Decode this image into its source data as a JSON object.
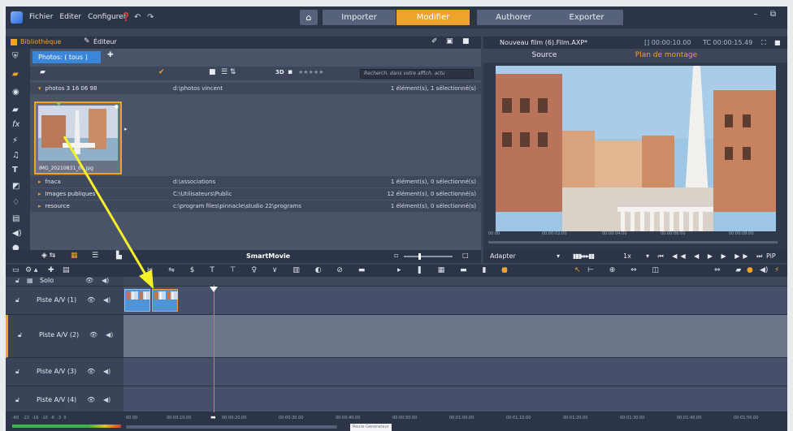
{
  "menu": {
    "file": "Fichier",
    "edit": "Editer",
    "config": "Configurer"
  },
  "nav_tabs": {
    "import": "Importer",
    "edit": "Modifier",
    "author": "Authorer",
    "export": "Exporter"
  },
  "library": {
    "header": "Bibliothèque",
    "editor": "Éditeur",
    "photos_tab": "Photos: ( tous )",
    "search_placeholder": "Recherch. dans votre affich. actu",
    "rows": [
      {
        "name": "photos 3 16 06 98",
        "path": "d:\\photos vincent",
        "count": "1 élément(s), 1 sélectionné(s)"
      },
      {
        "name": "fnaca",
        "path": "d:\\associations",
        "count": "1 élément(s), 0 sélectionné(s)"
      },
      {
        "name": "Images publiques",
        "path": "C:\\Utilisateurs\\Public",
        "count": "12 élément(s), 0 sélectionné(s)"
      },
      {
        "name": "resource",
        "path": "c:\\program files\\pinnacle\\studio 22\\programs",
        "count": "1 élément(s), 0 sélectionné(s)"
      }
    ],
    "thumb_caption": "IMG_20210831_0...jpg",
    "smartmovie": "SmartMovie"
  },
  "player": {
    "title": "Nouveau film (6).Film.AXP*",
    "tc1": "[] 00:00:10.00",
    "tc2": "TC 00:00:15.49",
    "tab_source": "Source",
    "tab_montage": "Plan de montage",
    "adapter": "Adapter",
    "speed": "1x",
    "pip": "PiP",
    "timecodes": [
      "00.00",
      "00:00:02:00",
      "00:00:04:00",
      "00:00:06:00",
      "00:00:08:00"
    ]
  },
  "timeline": {
    "solo": "Solo",
    "tracks": [
      "Piste A/V (1)",
      "Piste A/V (2)",
      "Piste A/V (3)",
      "Piste A/V (4)"
    ],
    "ruler": [
      "00.00",
      "00:00:10.00",
      "00:00:20.00",
      "00:00:30.00",
      "00:00:40.00",
      "00:00:50.00",
      "00:01:00.00",
      "00:01:10.00",
      "00:01:20.00",
      "00:01:30.00",
      "00:01:40.00",
      "00:01:50.00"
    ],
    "meter": [
      "-60",
      "-22",
      "-16",
      "-10",
      "-6",
      "-3",
      "0"
    ],
    "tooltip": "Route Générateur"
  },
  "colors": {
    "accent": "#f0a32c",
    "panel": "#3a4559",
    "clip": "#4d95d8",
    "arrow": "#f5f02a"
  }
}
